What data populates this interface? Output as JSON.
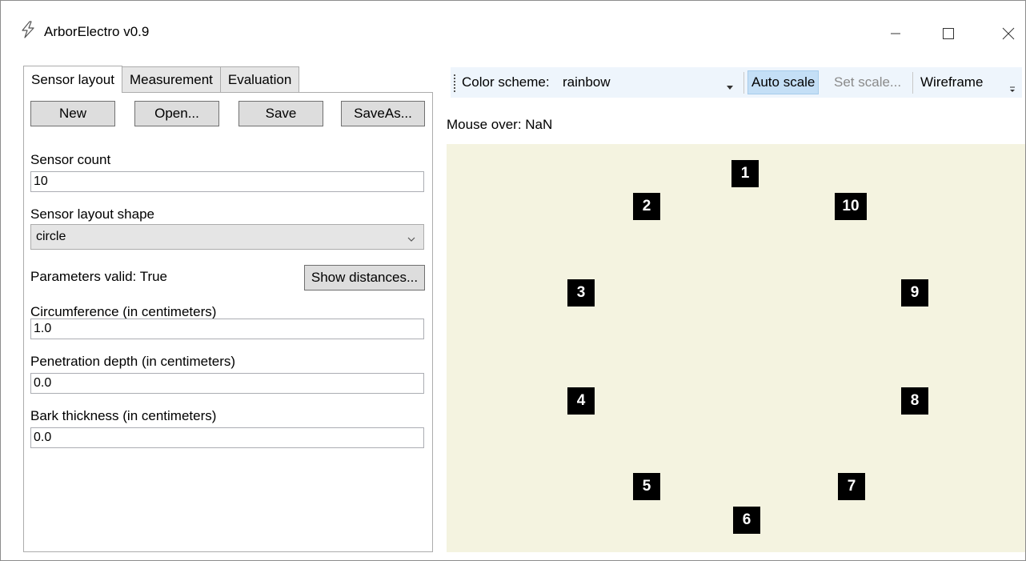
{
  "window": {
    "title": "ArborElectro v0.9",
    "app_icon": "lightning-icon",
    "controls": [
      "minimize-icon",
      "maximize-icon",
      "close-icon"
    ]
  },
  "tabs": [
    {
      "label": "Sensor layout",
      "active": true
    },
    {
      "label": "Measurement",
      "active": false
    },
    {
      "label": "Evaluation",
      "active": false
    }
  ],
  "sensor_layout": {
    "buttons": {
      "new": "New",
      "open": "Open...",
      "save": "Save",
      "save_as": "SaveAs..."
    },
    "sensor_count": {
      "label": "Sensor count",
      "value": "10"
    },
    "shape": {
      "label": "Sensor layout shape",
      "value": "circle"
    },
    "parameters_valid": "Parameters valid: True",
    "show_distances": "Show distances...",
    "circumference": {
      "label": "Circumference (in centimeters)",
      "value": "1.0"
    },
    "penetration_depth": {
      "label": "Penetration depth (in centimeters)",
      "value": "0.0"
    },
    "bark_thickness": {
      "label": "Bark thickness (in centimeters)",
      "value": "0.0"
    }
  },
  "toolbar": {
    "color_scheme_label": "Color scheme:",
    "color_scheme_value": "rainbow",
    "auto_scale": "Auto scale",
    "set_scale": "Set scale...",
    "wireframe": "Wireframe"
  },
  "mouse_over": "Mouse over: NaN",
  "plot": {
    "background": "#f4f3e0",
    "sensors": [
      "1",
      "2",
      "3",
      "4",
      "5",
      "6",
      "7",
      "8",
      "9",
      "10"
    ]
  }
}
